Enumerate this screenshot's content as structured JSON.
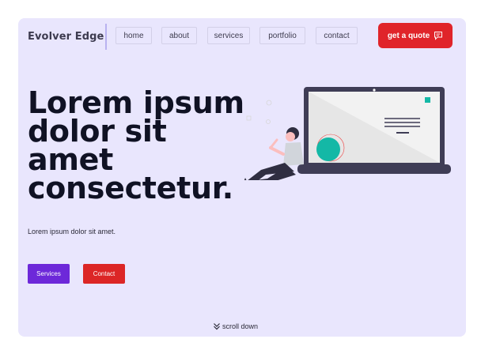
{
  "header": {
    "brand": "Evolver Edge",
    "nav": [
      {
        "label": "home"
      },
      {
        "label": "about"
      },
      {
        "label": "services"
      },
      {
        "label": "portfolio"
      },
      {
        "label": "contact"
      }
    ],
    "cta_label": "get a quote",
    "cta_icon": "chat-bubble-icon"
  },
  "hero": {
    "title": "Lorem ipsum dolor sit amet consectetur.",
    "subtitle": "Lorem ipsum dolor sit amet.",
    "buttons": {
      "services": "Services",
      "contact": "Contact"
    },
    "illustration": "person-with-laptop-illustration"
  },
  "footer": {
    "scroll_label": "scroll down",
    "scroll_icon": "double-chevron-down-icon"
  },
  "colors": {
    "background": "#e9e6fd",
    "accent_red": "#e0242a",
    "accent_purple": "#6d28d9",
    "text_dark": "#101224",
    "teal": "#14b8a6"
  }
}
